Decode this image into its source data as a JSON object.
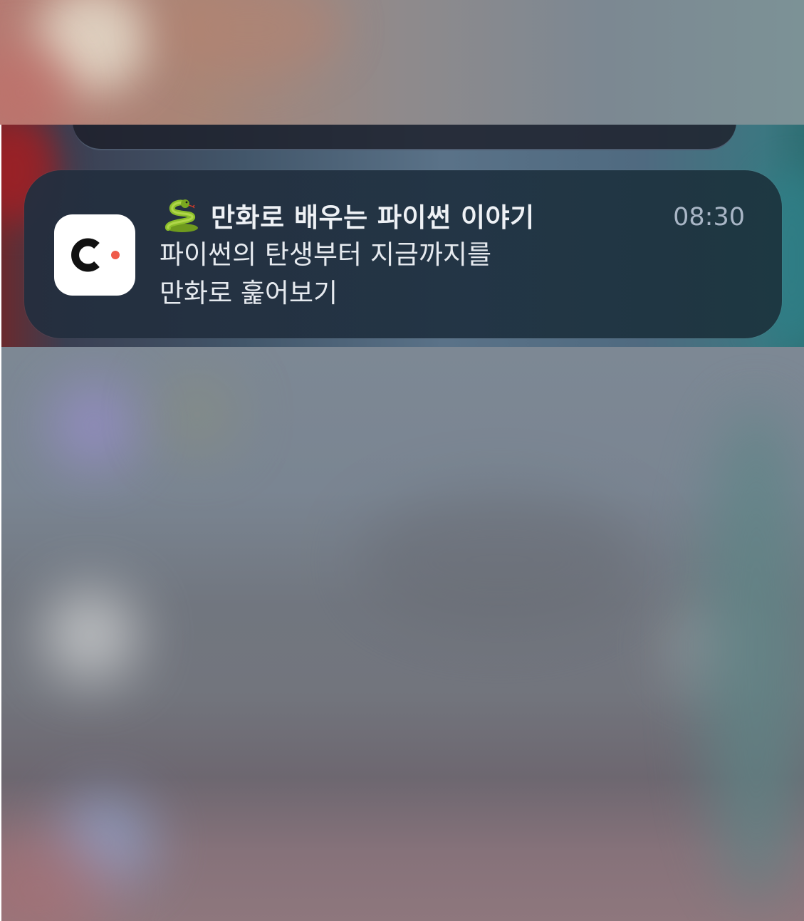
{
  "notification": {
    "app_icon": "app-c-logo-icon",
    "title_emoji_icon": "snake-icon",
    "title": "만화로 배우는 파이썬 이야기",
    "time": "08:30",
    "body": "파이썬의 탄생부터 지금까지를\n만화로 훑어보기"
  },
  "colors": {
    "card_background": "#243042",
    "title_text": "#eef1f5",
    "time_text": "#a9b6c6",
    "app_icon_dot": "#ef5b4a"
  }
}
